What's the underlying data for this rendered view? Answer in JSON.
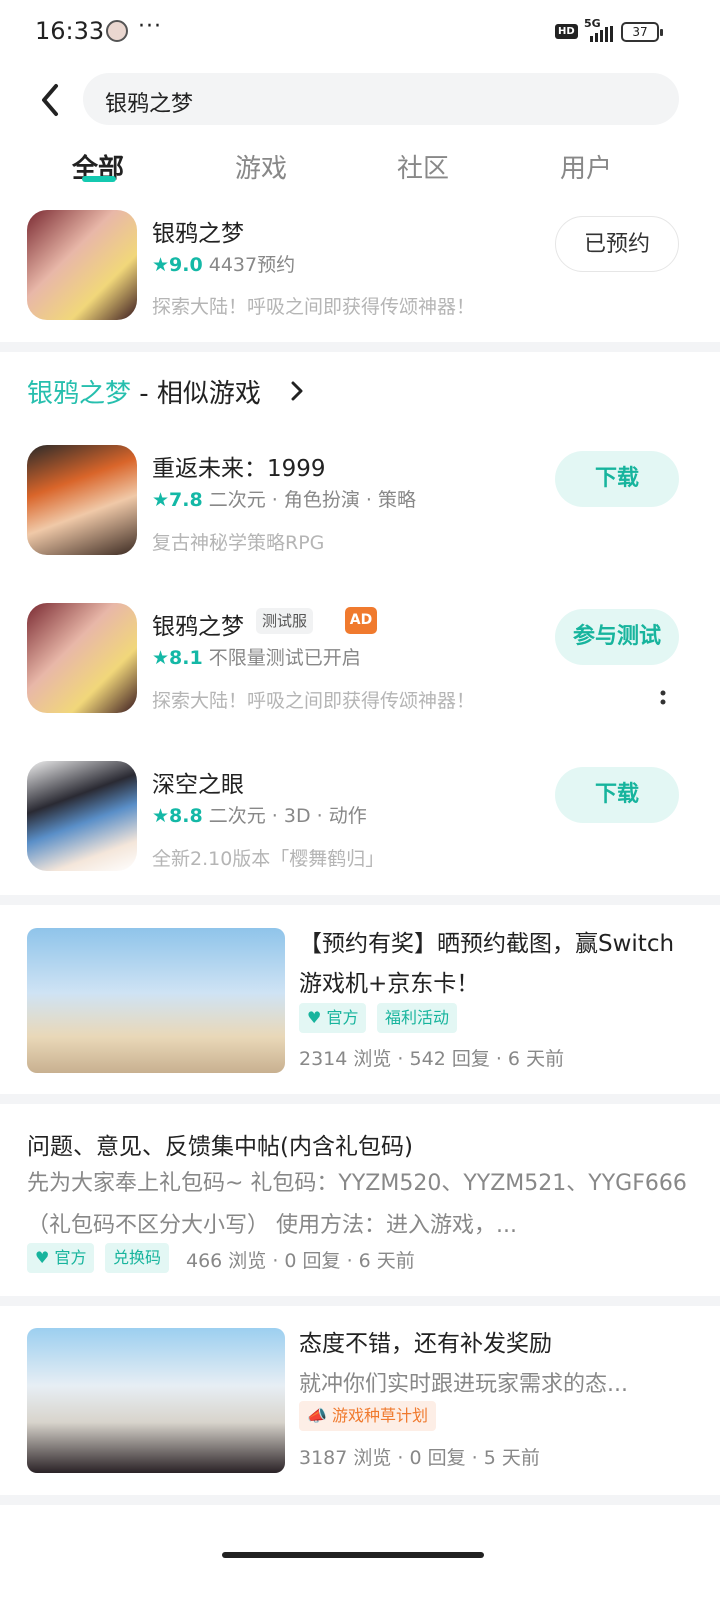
{
  "status_bar": {
    "time": "16:33",
    "dots": "···",
    "hd": "HD",
    "network": "5G",
    "battery": "37"
  },
  "search": {
    "query": "银鸦之梦"
  },
  "tabs": [
    {
      "label": "全部",
      "active": true
    },
    {
      "label": "游戏",
      "active": false
    },
    {
      "label": "社区",
      "active": false
    },
    {
      "label": "用户",
      "active": false
    }
  ],
  "top_app": {
    "name": "银鸦之梦",
    "rating": "★9.0",
    "reservations": "4437预约",
    "desc": "探索大陆！呼吸之间即获得传颂神器！",
    "button": "已预约"
  },
  "similar": {
    "highlight": "银鸦之梦",
    "rest": " - 相似游戏"
  },
  "similar_apps": [
    {
      "name": "重返未来：1999",
      "rating": "★7.8",
      "meta": "二次元 · 角色扮演 · 策略",
      "desc": "复古神秘学策略RPG",
      "button": "下载"
    },
    {
      "name": "银鸦之梦",
      "tag_test": "测试服",
      "tag_ad": "AD",
      "rating": "★8.1",
      "meta": "不限量测试已开启",
      "desc": "探索大陆！呼吸之间即获得传颂神器！",
      "button": "参与测试"
    },
    {
      "name": "深空之眼",
      "rating": "★8.8",
      "meta": "二次元 · 3D · 动作",
      "desc": "全新2.10版本「樱舞鹤归」",
      "button": "下载"
    }
  ],
  "posts": [
    {
      "title": "【预约有奖】晒预约截图，赢Switch游戏机+京东卡！",
      "badges": [
        "官方",
        "福利活动"
      ],
      "stats": "2314 浏览 · 542 回复 · 6 天前"
    },
    {
      "title": "问题、意见、反馈集中帖(内含礼包码)",
      "body": "先为大家奉上礼包码~ 礼包码：YYZM520、YYZM521、YYGF666（礼包码不区分大小写） 使用方法：进入游戏，...",
      "badges": [
        "官方",
        "兑换码"
      ],
      "stats": "466 浏览 · 0 回复 · 6 天前"
    },
    {
      "title": "态度不错，还有补发奖励",
      "body": "就冲你们实时跟进玩家需求的态...",
      "badges": [
        "游戏种草计划"
      ],
      "stats": "3187 浏览 · 0 回复 · 5 天前"
    }
  ],
  "colors": {
    "accent": "#14c9b0",
    "ad": "#f07a2e"
  }
}
